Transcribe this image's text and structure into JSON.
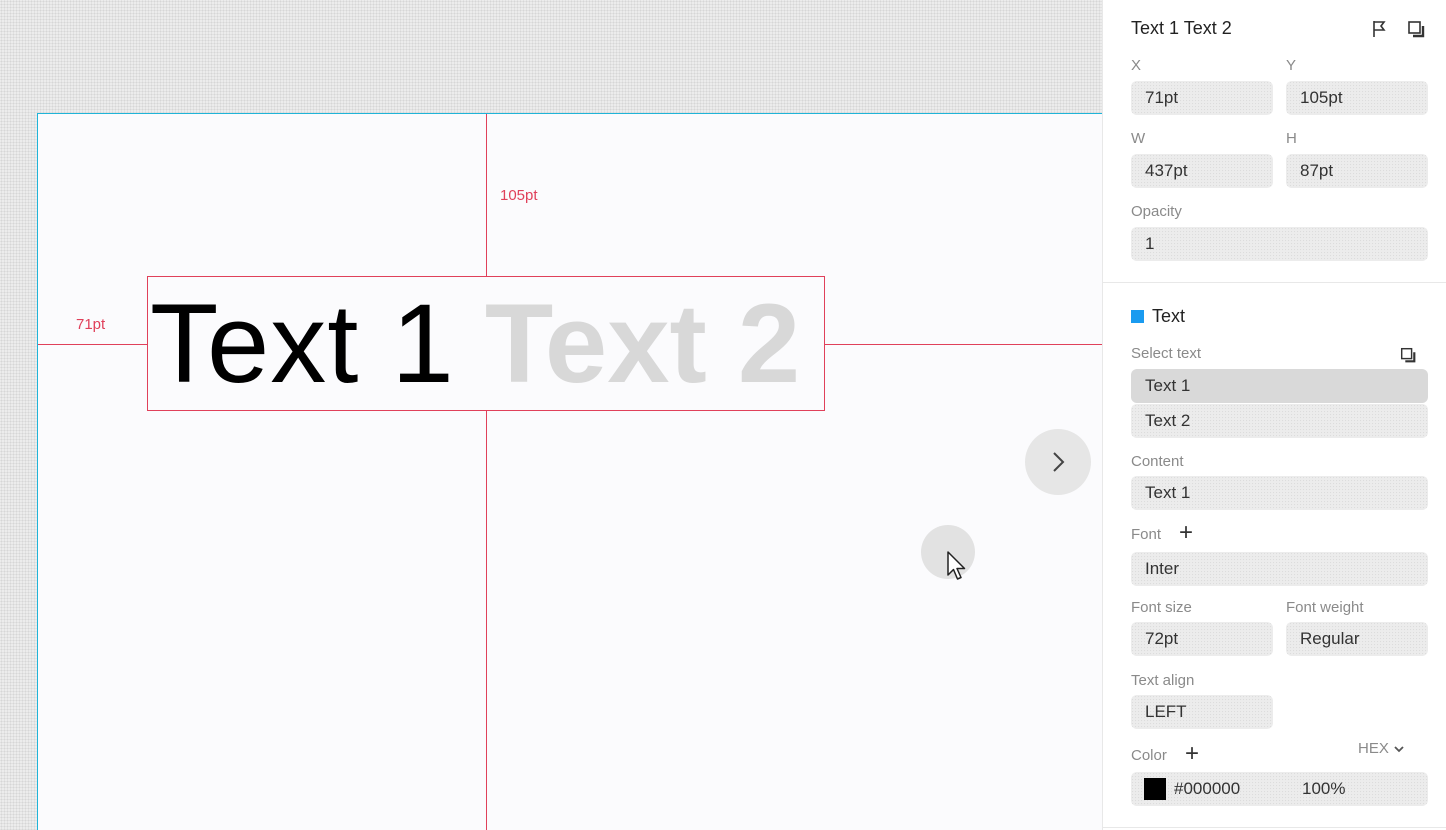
{
  "canvas": {
    "text_1": "Text 1",
    "text_2": "Text 2",
    "measure_top": "105pt",
    "measure_left": "71pt"
  },
  "panel": {
    "title": "Text 1 Text 2",
    "x_label": "X",
    "x_value": "71pt",
    "y_label": "Y",
    "y_value": "105pt",
    "w_label": "W",
    "w_value": "437pt",
    "h_label": "H",
    "h_value": "87pt",
    "opacity_label": "Opacity",
    "opacity_value": "1",
    "text_section": "Text",
    "select_text_label": "Select text",
    "select_items": [
      "Text 1",
      "Text 2"
    ],
    "content_label": "Content",
    "content_value": "Text 1",
    "font_label": "Font",
    "font_value": "Inter",
    "font_size_label": "Font size",
    "font_size_value": "72pt",
    "font_weight_label": "Font weight",
    "font_weight_value": "Regular",
    "text_align_label": "Text align",
    "text_align_value": "LEFT",
    "color_label": "Color",
    "color_mode": "HEX",
    "color_hex": "#000000",
    "color_opacity": "100%"
  },
  "colors": {
    "accent": "#1a9bf0",
    "guide": "#e0405a",
    "artboard_border": "#1fb4d8"
  }
}
